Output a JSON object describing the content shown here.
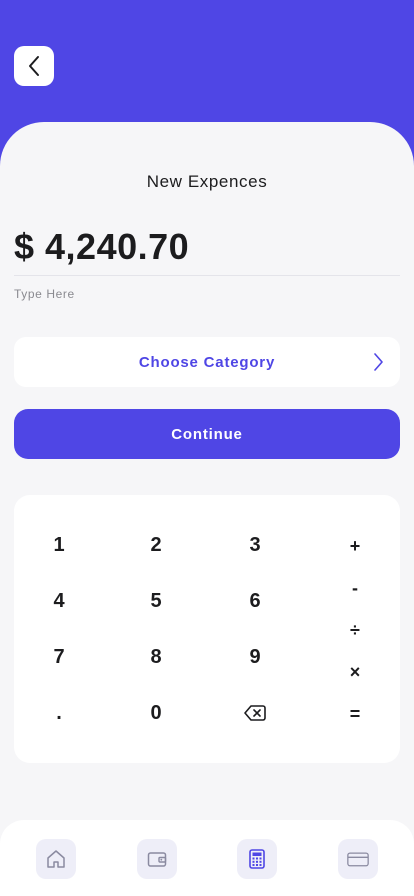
{
  "header": {
    "back_icon": "chevron-left-icon"
  },
  "screen": {
    "title": "New Expences",
    "amount": "$ 4,240.70",
    "hint": "Type Here",
    "category_label": "Choose Category",
    "continue_label": "Continue"
  },
  "keypad": {
    "digits": [
      "1",
      "2",
      "3",
      "4",
      "5",
      "6",
      "7",
      "8",
      "9",
      ".",
      "0"
    ],
    "backspace_icon": "backspace-icon",
    "operators": [
      "+",
      "-",
      "÷",
      "×",
      "="
    ]
  },
  "tabbar": {
    "tabs": [
      {
        "icon": "home-icon",
        "active": false
      },
      {
        "icon": "wallet-icon",
        "active": false
      },
      {
        "icon": "calculator-icon",
        "active": true
      },
      {
        "icon": "credit-card-icon",
        "active": false
      }
    ]
  },
  "colors": {
    "accent": "#4F46E5",
    "background": "#F6F6F8",
    "text": "#1C1C1E"
  }
}
